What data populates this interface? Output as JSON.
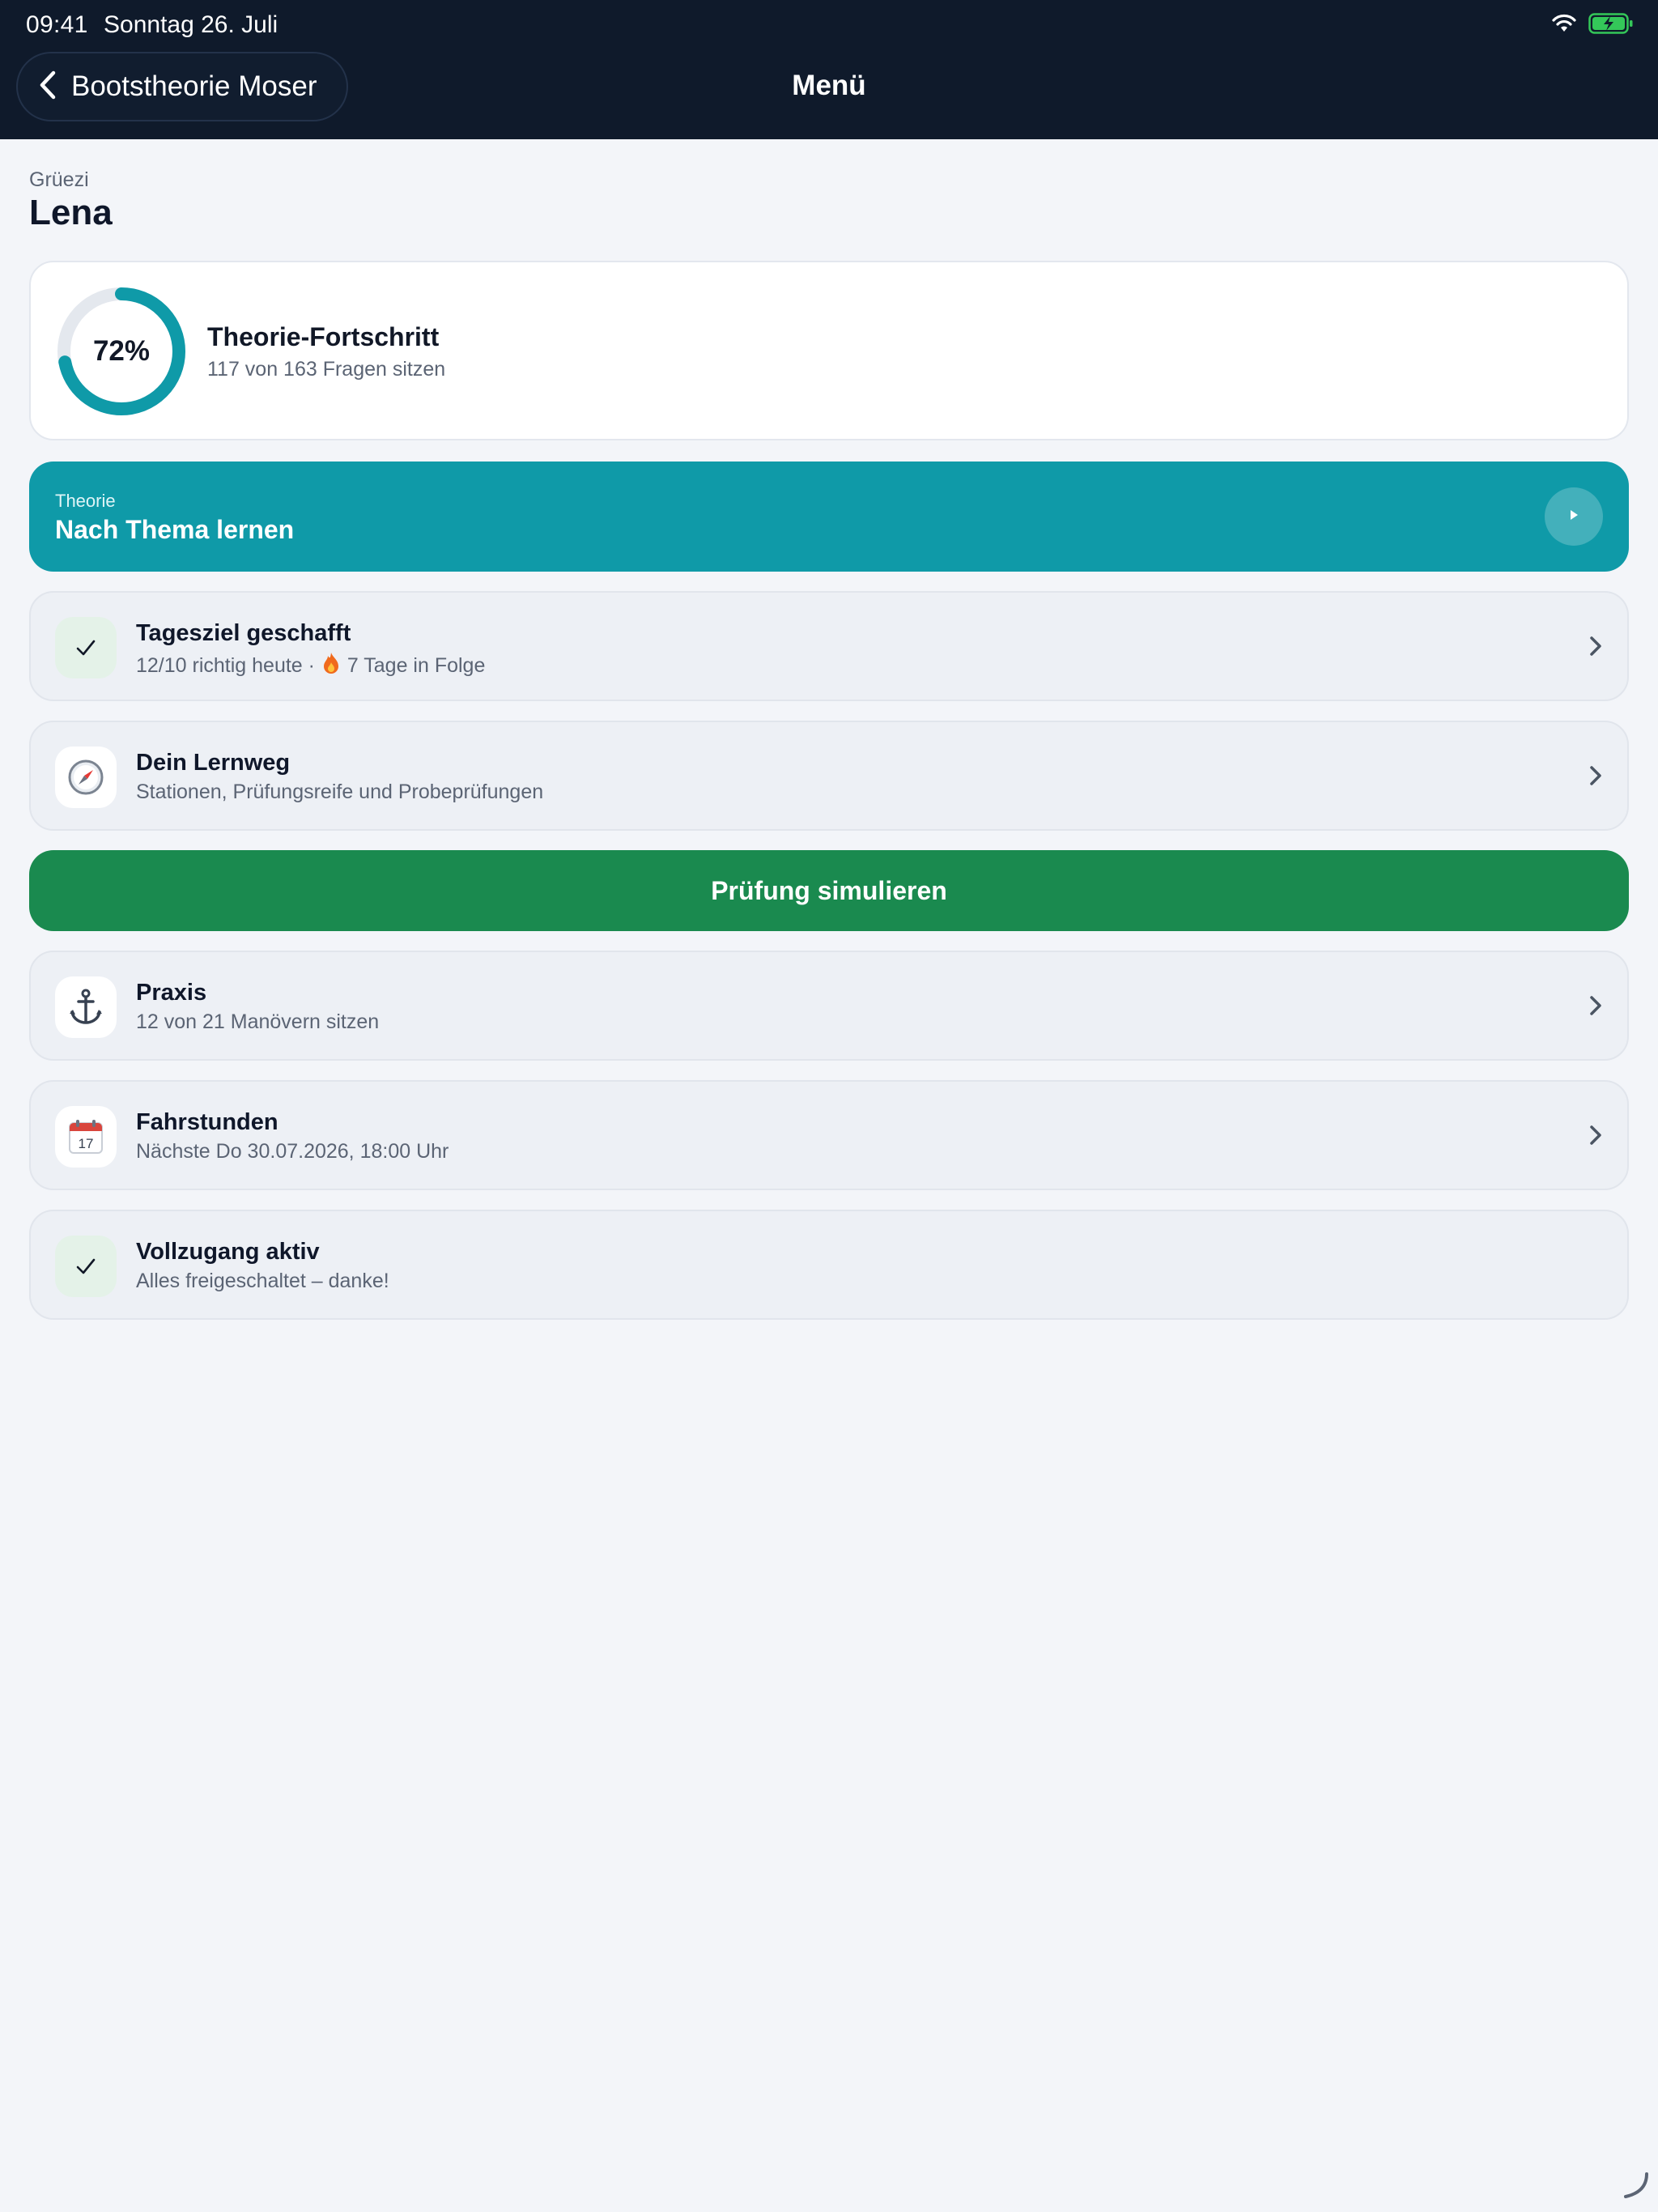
{
  "status_bar": {
    "time": "09:41",
    "date": "Sonntag 26. Juli"
  },
  "nav": {
    "back_label": "Bootstheorie Moser",
    "title": "Menü"
  },
  "greeting": {
    "salutation": "Grüezi",
    "name": "Lena"
  },
  "progress": {
    "percent_label": "72%",
    "percent_value": 72,
    "title": "Theorie-Fortschritt",
    "subtitle": "117 von 163 Fragen sitzen"
  },
  "theory": {
    "eyebrow": "Theorie",
    "title": "Nach Thema lernen"
  },
  "daily_goal": {
    "title": "Tagesziel geschafft",
    "sub_prefix": "12/10 richtig heute · ",
    "sub_suffix": " 7 Tage in Folge",
    "icon": "checkmark-icon"
  },
  "learning_path": {
    "title": "Dein Lernweg",
    "subtitle": "Stationen, Prüfungsreife und Probeprüfungen",
    "icon": "compass-icon"
  },
  "exam": {
    "label": "Prüfung simulieren"
  },
  "practice": {
    "title": "Praxis",
    "subtitle": "12 von 21 Manövern sitzen",
    "icon": "anchor-icon"
  },
  "lessons": {
    "title": "Fahrstunden",
    "subtitle": "Nächste Do 30.07.2026, 18:00 Uhr",
    "calendar_day": "17",
    "icon": "calendar-icon"
  },
  "access": {
    "title": "Vollzugang aktiv",
    "subtitle": "Alles freigeschaltet – danke!",
    "icon": "checkmark-icon"
  },
  "colors": {
    "topbar": "#0f1a2b",
    "teal": "#0f9aa8",
    "green": "#1a8a4f",
    "background": "#f3f5f9"
  }
}
